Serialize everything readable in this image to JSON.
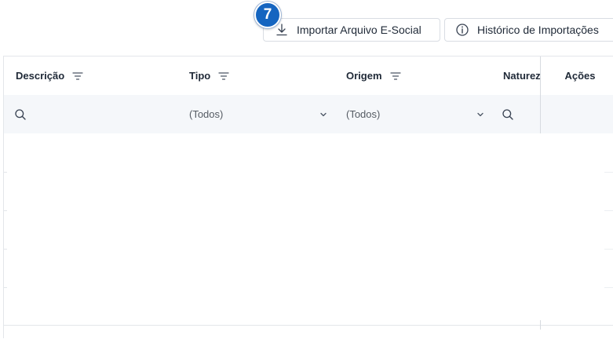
{
  "toolbar": {
    "import_label": "Importar Arquivo E-Social",
    "history_label": "Histórico de Importações",
    "step_badge": "7"
  },
  "grid": {
    "columns": [
      {
        "label": "Descrição",
        "filter_icon": "filter-lines-icon"
      },
      {
        "label": "Tipo",
        "filter_icon": "filter-lines-icon"
      },
      {
        "label": "Origem",
        "filter_icon": "filter-lines-icon"
      },
      {
        "label": "Natureza"
      },
      {
        "label": "Ações"
      }
    ],
    "filters": {
      "tipo_value": "(Todos)",
      "origem_value": "(Todos)"
    }
  },
  "colors": {
    "badge": "#1565c0",
    "border": "#e3e6ea",
    "filter_row_bg": "#f5f7fa"
  }
}
